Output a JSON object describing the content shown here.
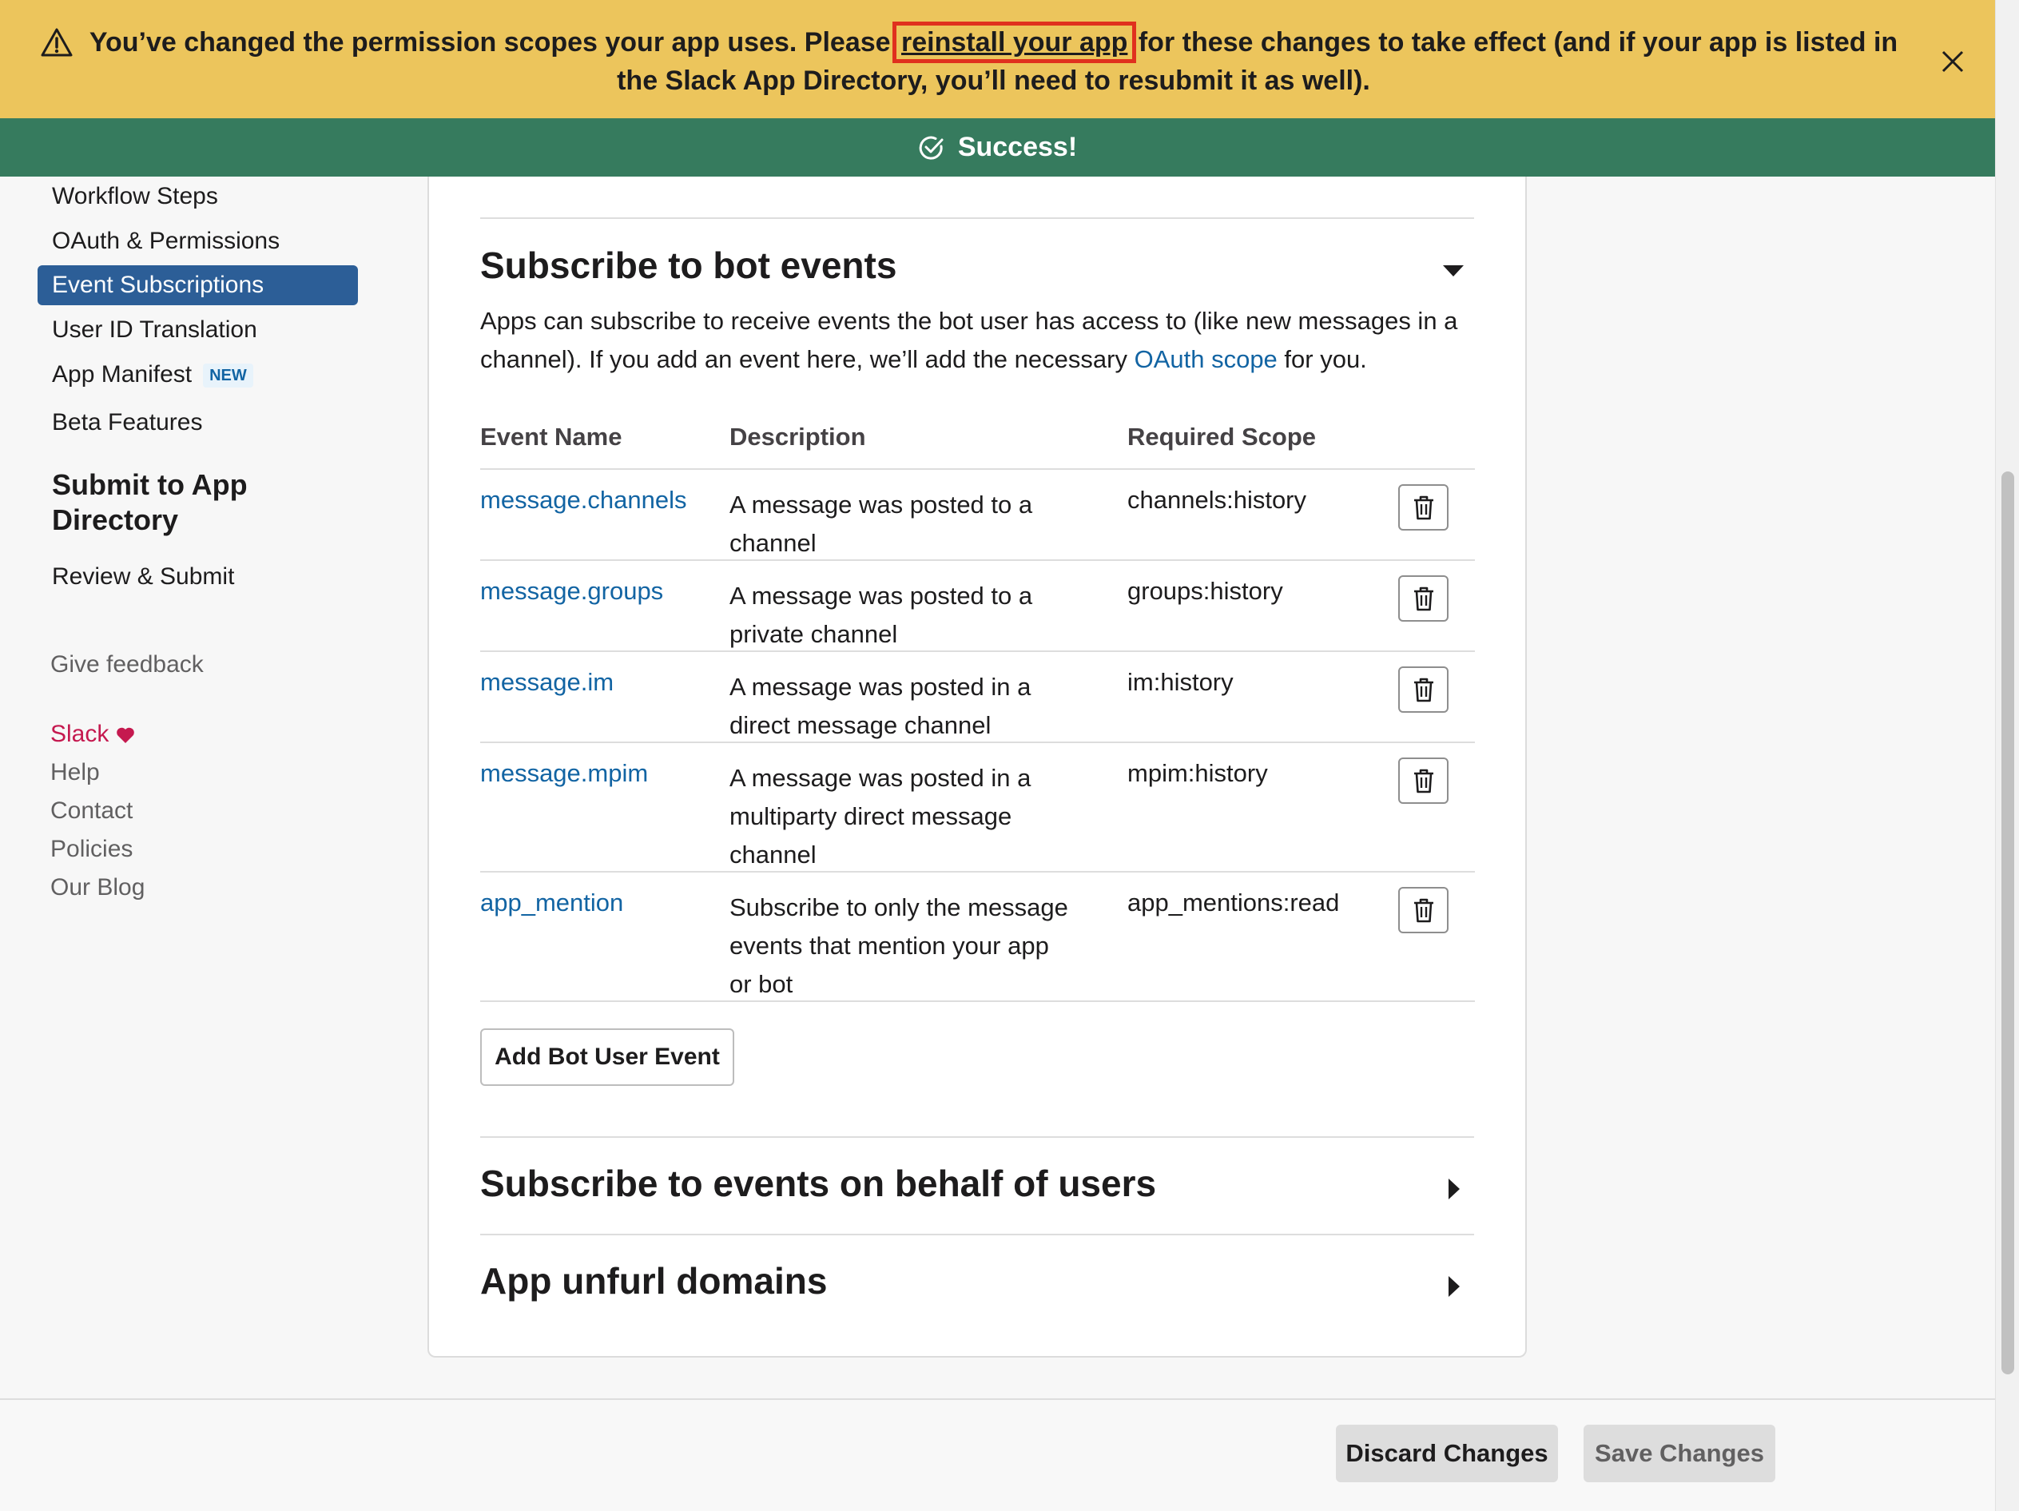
{
  "banner": {
    "before_link": "You’ve changed the permission scopes your app uses. Please ",
    "link": "reinstall your app",
    "after_link": " for these changes to take effect (and if your app is listed in the Slack App Directory, you’ll need to resubmit it as well).",
    "icon": "warning-icon",
    "close_icon": "close-icon",
    "color": "#ecc55c"
  },
  "success": {
    "text": "Success!",
    "icon": "check-circle-icon",
    "color": "#367b5e"
  },
  "sidebar": {
    "items": [
      {
        "label": "Workflow Steps"
      },
      {
        "label": "OAuth & Permissions"
      },
      {
        "label": "Event Subscriptions",
        "active": true
      },
      {
        "label": "User ID Translation"
      },
      {
        "label": "App Manifest",
        "badge": "NEW"
      },
      {
        "label": "Beta Features"
      }
    ],
    "submit_heading": "Submit to App Directory",
    "submit_items": [
      {
        "label": "Review & Submit"
      }
    ],
    "feedback": "Give feedback",
    "footer_links": [
      {
        "label": "Slack",
        "icon": "heart-icon"
      },
      {
        "label": "Help"
      },
      {
        "label": "Contact"
      },
      {
        "label": "Policies"
      },
      {
        "label": "Our Blog"
      }
    ],
    "active_color": "#2c5e97"
  },
  "bot_events": {
    "title": "Subscribe to bot events",
    "intro_before": "Apps can subscribe to receive events the bot user has access to (like new messages in a channel). If you add an event here, we’ll add the necessary ",
    "intro_link": "OAuth scope",
    "intro_after": " for you.",
    "columns": [
      "Event Name",
      "Description",
      "Required Scope"
    ],
    "rows": [
      {
        "event": "message.channels",
        "description": "A message was posted to a channel",
        "scope": "channels:history"
      },
      {
        "event": "message.groups",
        "description": "A message was posted to a private channel",
        "scope": "groups:history"
      },
      {
        "event": "message.im",
        "description": "A message was posted in a direct message channel",
        "scope": "im:history"
      },
      {
        "event": "message.mpim",
        "description": "A message was posted in a multiparty direct message channel",
        "scope": "mpim:history"
      },
      {
        "event": "app_mention",
        "description": "Subscribe to only the message events that mention your app or bot",
        "scope": "app_mentions:read"
      }
    ],
    "add_button": "Add Bot User Event"
  },
  "user_events": {
    "title": "Subscribe to events on behalf of users"
  },
  "unfurl": {
    "title": "App unfurl domains"
  },
  "footer": {
    "discard": "Discard Changes",
    "save": "Save Changes"
  }
}
